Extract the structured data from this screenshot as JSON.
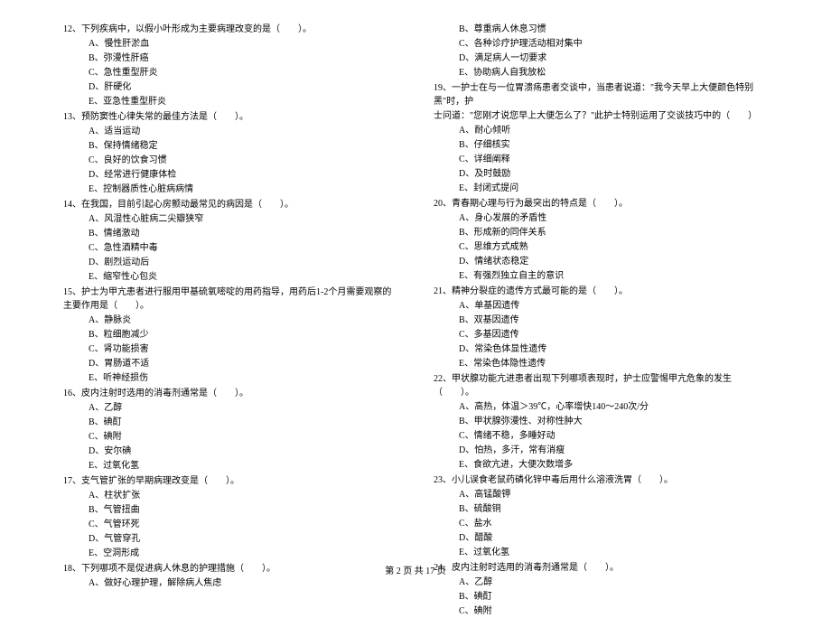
{
  "footer": "第 2 页 共 17 页",
  "left": [
    {
      "num": "12",
      "stem": "、下列疾病中，以假小叶形成为主要病理改变的是（　　）。",
      "options": [
        "A、慢性肝淤血",
        "B、弥漫性肝癌",
        "C、急性重型肝炎",
        "D、肝硬化",
        "E、亚急性重型肝炎"
      ]
    },
    {
      "num": "13",
      "stem": "、预防窦性心律失常的最佳方法是（　　）。",
      "options": [
        "A、适当运动",
        "B、保持情绪稳定",
        "C、良好的饮食习惯",
        "D、经常进行健康体检",
        "E、控制器质性心脏病病情"
      ]
    },
    {
      "num": "14",
      "stem": "、在我国，目前引起心房颤动最常见的病因是（　　）。",
      "options": [
        "A、风湿性心脏病二尖瓣狭窄",
        "B、情绪激动",
        "C、急性酒精中毒",
        "D、剧烈运动后",
        "E、缩窄性心包炎"
      ]
    },
    {
      "num": "15",
      "stem": "、护士为甲亢患者进行服用甲基硫氧嘧啶的用药指导，用药后1-2个月需要观察的主要作用是（　　）。",
      "options": [
        "A、静脉炎",
        "B、粒细胞减少",
        "C、肾功能损害",
        "D、胃肠道不适",
        "E、听神经损伤"
      ]
    },
    {
      "num": "16",
      "stem": "、皮内注射时选用的消毒剂通常是（　　）。",
      "options": [
        "A、乙醇",
        "B、碘酊",
        "C、碘附",
        "D、安尔碘",
        "E、过氧化氢"
      ]
    },
    {
      "num": "17",
      "stem": "、支气管扩张的早期病理改变是（　　）。",
      "options": [
        "A、柱状扩张",
        "B、气管扭曲",
        "C、气管环死",
        "D、气管穿孔",
        "E、空洞形成"
      ]
    },
    {
      "num": "18",
      "stem": "、下列哪项不是促进病人休息的护理措施（　　）。",
      "options": [
        "A、做好心理护理，解除病人焦虑"
      ]
    }
  ],
  "right_lead": {
    "options": [
      "B、尊重病人休息习惯",
      "C、各种诊疗护理活动相对集中",
      "D、满足病人一切要求",
      "E、协助病人自我放松"
    ]
  },
  "right": [
    {
      "num": "19",
      "stem": "、一护士在与一位胃溃疡患者交谈中，当患者说道：\"我今天早上大便颜色特别黑\"时，护",
      "stem2": "士问道：\"您刚才说您早上大便怎么了？\"此护士特别运用了交谈技巧中的（　　）",
      "options": [
        "A、耐心倾听",
        "B、仔细核实",
        "C、详细阐释",
        "D、及时鼓励",
        "E、封闭式提问"
      ]
    },
    {
      "num": "20",
      "stem": "、青春期心理与行为最突出的特点是（　　）。",
      "options": [
        "A、身心发展的矛盾性",
        "B、形成新的同伴关系",
        "C、思维方式成熟",
        "D、情绪状态稳定",
        "E、有强烈独立自主的意识"
      ]
    },
    {
      "num": "21",
      "stem": "、精神分裂症的遗传方式最可能的是（　　）。",
      "options": [
        "A、单基因遗传",
        "B、双基因遗传",
        "C、多基因遗传",
        "D、常染色体显性遗传",
        "E、常染色体隐性遗传"
      ]
    },
    {
      "num": "22",
      "stem": "、甲状腺功能亢进患者出现下列哪项表现时，护士应警惕甲亢危象的发生（　　）。",
      "options": [
        "A、高热，体温＞39℃，心率增快140～240次/分",
        "B、甲状腺弥漫性、对称性肿大",
        "C、情绪不稳，多睡好动",
        "D、怕热，多汗，常有消瘦",
        "E、食欲亢进，大便次数增多"
      ]
    },
    {
      "num": "23",
      "stem": "、小儿误食老鼠药磷化锌中毒后用什么溶液洗胃（　　）。",
      "options": [
        "A、高锰酸钾",
        "B、硫酸铜",
        "C、盐水",
        "D、醋酸",
        "E、过氧化氢"
      ]
    },
    {
      "num": "24",
      "stem": "、皮内注射时选用的消毒剂通常是（　　）。",
      "options": [
        "A、乙醇",
        "B、碘酊",
        "C、碘附"
      ]
    }
  ]
}
